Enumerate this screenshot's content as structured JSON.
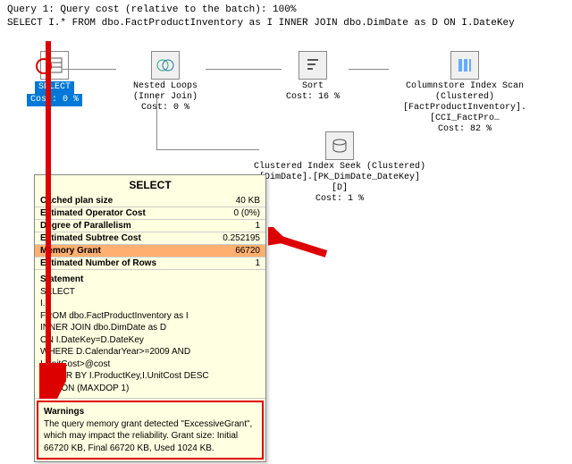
{
  "header": {
    "line1": "Query 1: Query cost (relative to the batch): 100%",
    "line2": "SELECT I.* FROM dbo.FactProductInventory as I INNER JOIN dbo.DimDate as D ON I.DateKey"
  },
  "plan": {
    "select": {
      "label": "SELECT",
      "cost": "Cost: 0 %"
    },
    "nested": {
      "title": "Nested Loops",
      "sub": "(Inner Join)",
      "cost": "Cost: 0 %"
    },
    "sort": {
      "title": "Sort",
      "cost": "Cost: 16 %"
    },
    "colscan": {
      "title": "Columnstore Index Scan (Clustered)",
      "obj": "[FactProductInventory].[CCI_FactPro…",
      "cost": "Cost: 82 %"
    },
    "seek": {
      "title": "Clustered Index Seek (Clustered)",
      "obj": "[DimDate].[PK_DimDate_DateKey] [D]",
      "cost": "Cost: 1 %"
    }
  },
  "tooltip": {
    "title": "SELECT",
    "props": {
      "cached_plan_size": {
        "label": "Cached plan size",
        "value": "40 KB"
      },
      "est_op_cost": {
        "label": "Estimated Operator Cost",
        "value": "0 (0%)"
      },
      "dop": {
        "label": "Degree of Parallelism",
        "value": "1"
      },
      "est_subtree": {
        "label": "Estimated Subtree Cost",
        "value": "0.252195"
      },
      "mem_grant": {
        "label": "Memory Grant",
        "value": "66720"
      },
      "est_rows": {
        "label": "Estimated Number of Rows",
        "value": "1"
      }
    },
    "statement": {
      "header": "Statement",
      "lines": [
        "SELECT",
        "I.*",
        "FROM dbo.FactProductInventory as I",
        "INNER JOIN dbo.DimDate as D",
        "ON I.DateKey=D.DateKey",
        "WHERE D.CalendarYear>=2009 AND",
        "I.UnitCost>@cost",
        "ORDER BY I.ProductKey,I.UnitCost DESC",
        "OPTION (MAXDOP 1)"
      ]
    },
    "warnings": {
      "header": "Warnings",
      "text": "The query memory grant detected \"ExcessiveGrant\", which may impact the reliability. Grant size: Initial 66720 KB, Final 66720 KB, Used 1024 KB."
    }
  }
}
